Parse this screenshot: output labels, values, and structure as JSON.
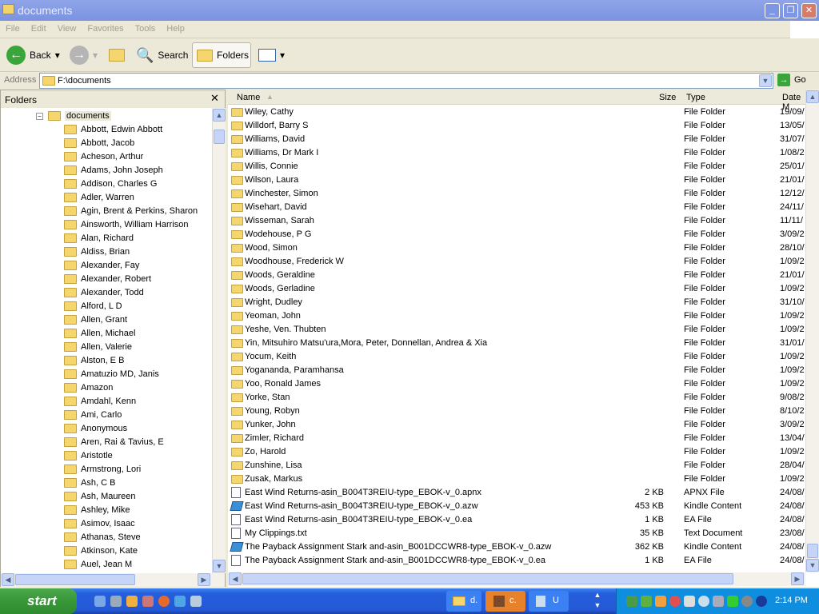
{
  "window": {
    "title": "documents"
  },
  "menu": [
    "File",
    "Edit",
    "View",
    "Favorites",
    "Tools",
    "Help"
  ],
  "toolbar": {
    "back": "Back",
    "search": "Search",
    "folders": "Folders"
  },
  "address": {
    "label": "Address",
    "value": "F:\\documents",
    "go": "Go"
  },
  "folders_pane": {
    "title": "Folders",
    "root": "documents",
    "items": [
      "Abbott, Edwin Abbott",
      "Abbott, Jacob",
      "Acheson, Arthur",
      "Adams, John Joseph",
      "Addison, Charles G",
      "Adler, Warren",
      "Agin, Brent & Perkins, Sharon",
      "Ainsworth, William Harrison",
      "Alan, Richard",
      "Aldiss, Brian",
      "Alexander, Fay",
      "Alexander, Robert",
      "Alexander, Todd",
      "Alford, L D",
      "Allen, Grant",
      "Allen, Michael",
      "Allen, Valerie",
      "Alston, E B",
      "Amatuzio MD, Janis",
      "Amazon",
      "Amdahl, Kenn",
      "Ami, Carlo",
      "Anonymous",
      "Aren, Rai & Tavius, E",
      "Aristotle",
      "Armstrong, Lori",
      "Ash, C B",
      "Ash, Maureen",
      "Ashley, Mike",
      "Asimov, Isaac",
      "Athanas, Steve",
      "Atkinson, Kate",
      "Auel, Jean M"
    ]
  },
  "columns": {
    "name": "Name",
    "size": "Size",
    "type": "Type",
    "date": "Date M"
  },
  "files": [
    {
      "name": "Wiley, Cathy",
      "size": "",
      "type": "File Folder",
      "date": "19/09/",
      "kind": "folder"
    },
    {
      "name": "Willdorf, Barry S",
      "size": "",
      "type": "File Folder",
      "date": "13/05/",
      "kind": "folder"
    },
    {
      "name": "Williams, David",
      "size": "",
      "type": "File Folder",
      "date": "31/07/",
      "kind": "folder"
    },
    {
      "name": "Williams, Dr Mark I",
      "size": "",
      "type": "File Folder",
      "date": "1/08/2",
      "kind": "folder"
    },
    {
      "name": "Willis, Connie",
      "size": "",
      "type": "File Folder",
      "date": "25/01/",
      "kind": "folder"
    },
    {
      "name": "Wilson, Laura",
      "size": "",
      "type": "File Folder",
      "date": "21/01/",
      "kind": "folder"
    },
    {
      "name": "Winchester, Simon",
      "size": "",
      "type": "File Folder",
      "date": "12/12/",
      "kind": "folder"
    },
    {
      "name": "Wisehart, David",
      "size": "",
      "type": "File Folder",
      "date": "24/11/",
      "kind": "folder"
    },
    {
      "name": "Wisseman, Sarah",
      "size": "",
      "type": "File Folder",
      "date": "11/11/",
      "kind": "folder"
    },
    {
      "name": "Wodehouse, P G",
      "size": "",
      "type": "File Folder",
      "date": "3/09/2",
      "kind": "folder"
    },
    {
      "name": "Wood, Simon",
      "size": "",
      "type": "File Folder",
      "date": "28/10/",
      "kind": "folder"
    },
    {
      "name": "Woodhouse, Frederick W",
      "size": "",
      "type": "File Folder",
      "date": "1/09/2",
      "kind": "folder"
    },
    {
      "name": "Woods, Geraldine",
      "size": "",
      "type": "File Folder",
      "date": "21/01/",
      "kind": "folder"
    },
    {
      "name": "Woods, Gerladine",
      "size": "",
      "type": "File Folder",
      "date": "1/09/2",
      "kind": "folder"
    },
    {
      "name": "Wright, Dudley",
      "size": "",
      "type": "File Folder",
      "date": "31/10/",
      "kind": "folder"
    },
    {
      "name": "Yeoman, John",
      "size": "",
      "type": "File Folder",
      "date": "1/09/2",
      "kind": "folder"
    },
    {
      "name": "Yeshe, Ven. Thubten",
      "size": "",
      "type": "File Folder",
      "date": "1/09/2",
      "kind": "folder"
    },
    {
      "name": "Yin, Mitsuhiro Matsu'ura,Mora, Peter, Donnellan, Andrea & Xia",
      "size": "",
      "type": "File Folder",
      "date": "31/01/",
      "kind": "folder"
    },
    {
      "name": "Yocum, Keith",
      "size": "",
      "type": "File Folder",
      "date": "1/09/2",
      "kind": "folder"
    },
    {
      "name": "Yogananda, Paramhansa",
      "size": "",
      "type": "File Folder",
      "date": "1/09/2",
      "kind": "folder"
    },
    {
      "name": "Yoo, Ronald James",
      "size": "",
      "type": "File Folder",
      "date": "1/09/2",
      "kind": "folder"
    },
    {
      "name": "Yorke, Stan",
      "size": "",
      "type": "File Folder",
      "date": "9/08/2",
      "kind": "folder"
    },
    {
      "name": "Young, Robyn",
      "size": "",
      "type": "File Folder",
      "date": "8/10/2",
      "kind": "folder"
    },
    {
      "name": "Yunker, John",
      "size": "",
      "type": "File Folder",
      "date": "3/09/2",
      "kind": "folder"
    },
    {
      "name": "Zimler, Richard",
      "size": "",
      "type": "File Folder",
      "date": "13/04/",
      "kind": "folder"
    },
    {
      "name": "Zo, Harold",
      "size": "",
      "type": "File Folder",
      "date": "1/09/2",
      "kind": "folder"
    },
    {
      "name": "Zunshine, Lisa",
      "size": "",
      "type": "File Folder",
      "date": "28/04/",
      "kind": "folder"
    },
    {
      "name": "Zusak, Markus",
      "size": "",
      "type": "File Folder",
      "date": "1/09/2",
      "kind": "folder"
    },
    {
      "name": "East Wind Returns-asin_B004T3REIU-type_EBOK-v_0.apnx",
      "size": "2 KB",
      "type": "APNX File",
      "date": "24/08/",
      "kind": "file"
    },
    {
      "name": "East Wind Returns-asin_B004T3REIU-type_EBOK-v_0.azw",
      "size": "453 KB",
      "type": "Kindle Content",
      "date": "24/08/",
      "kind": "kindle"
    },
    {
      "name": "East Wind Returns-asin_B004T3REIU-type_EBOK-v_0.ea",
      "size": "1 KB",
      "type": "EA File",
      "date": "24/08/",
      "kind": "file"
    },
    {
      "name": "My Clippings.txt",
      "size": "35 KB",
      "type": "Text Document",
      "date": "23/08/",
      "kind": "file"
    },
    {
      "name": "The Payback Assignment Stark and-asin_B001DCCWR8-type_EBOK-v_0.azw",
      "size": "362 KB",
      "type": "Kindle Content",
      "date": "24/08/",
      "kind": "kindle"
    },
    {
      "name": "The Payback Assignment Stark and-asin_B001DCCWR8-type_EBOK-v_0.ea",
      "size": "1 KB",
      "type": "EA File",
      "date": "24/08/",
      "kind": "file"
    }
  ],
  "taskbar": {
    "start": "start",
    "tasks": [
      "d.",
      "c.",
      "U"
    ],
    "clock": "2:14 PM"
  }
}
